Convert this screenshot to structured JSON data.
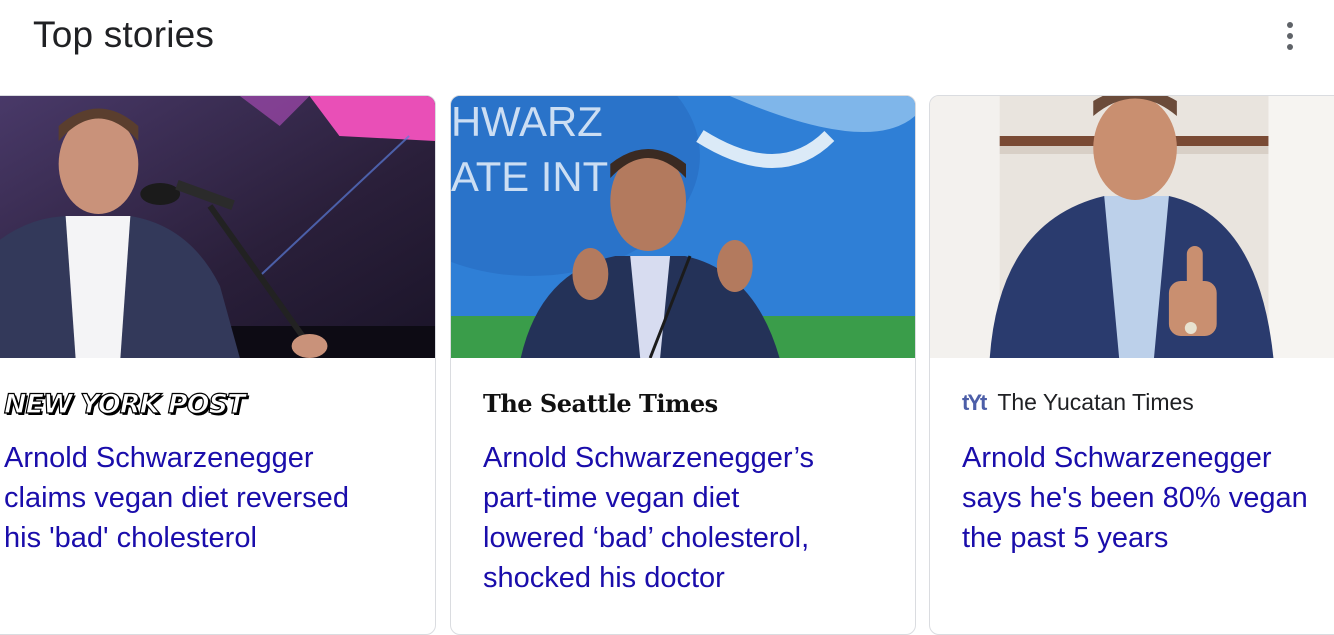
{
  "header": {
    "title": "Top stories",
    "more_icon": "more-vert-icon"
  },
  "cards": [
    {
      "source": "NEW YORK POST",
      "headline": "Arnold Schwarzenegger\nclaims vegan diet reversed\nhis 'bad' cholesterol"
    },
    {
      "source": "The Seattle Times",
      "headline": "Arnold Schwarzenegger’s\npart-time vegan diet\nlowered ‘bad’ cholesterol,\nshocked his doctor"
    },
    {
      "source_icon": "tYt",
      "source": "The Yucatan Times",
      "headline": "Arnold Schwarzenegger\nsays he's been 80% vegan\nthe past 5 years"
    }
  ],
  "thumb2_text": "HWARZ\nATE INT"
}
